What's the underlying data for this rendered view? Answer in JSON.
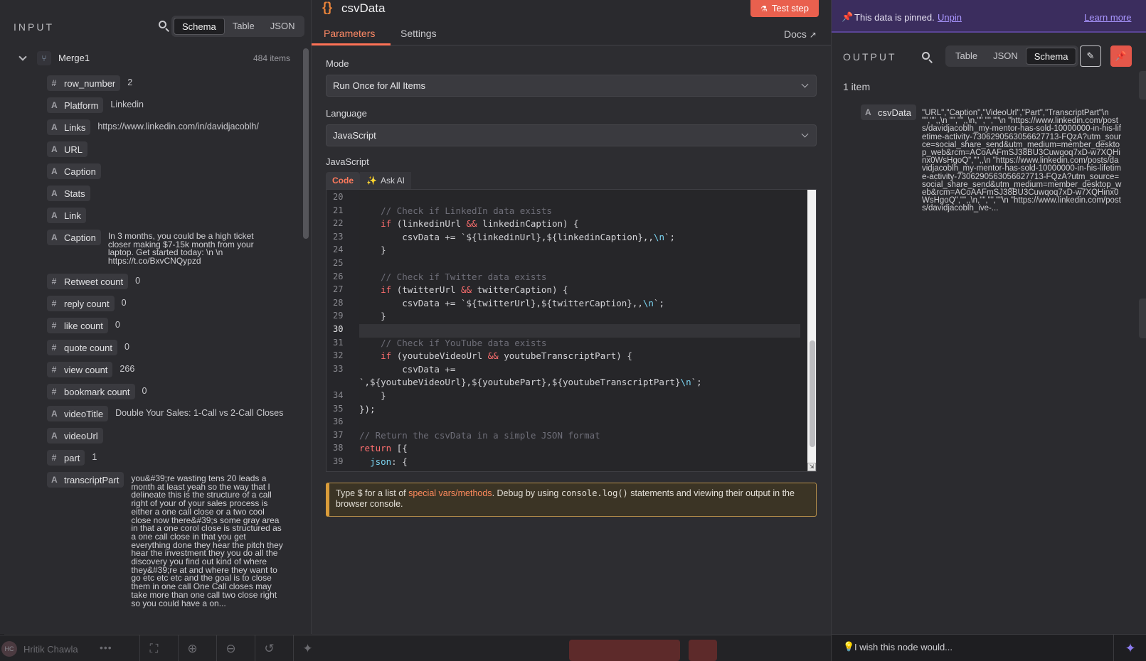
{
  "input": {
    "title": "INPUT",
    "view_tabs": [
      "Schema",
      "Table",
      "JSON"
    ],
    "active_view": "Schema",
    "node_name": "Merge1",
    "item_count": "484 items",
    "fields": [
      {
        "type": "#",
        "name": "row_number",
        "value": "2"
      },
      {
        "type": "A",
        "name": "Platform",
        "value": "Linkedin"
      },
      {
        "type": "A",
        "name": "Links",
        "value": "https://www.linkedin.com/in/davidjacoblh/"
      },
      {
        "type": "A",
        "name": "URL",
        "value": ""
      },
      {
        "type": "A",
        "name": "Caption",
        "value": ""
      },
      {
        "type": "A",
        "name": "Stats",
        "value": ""
      },
      {
        "type": "A",
        "name": "Link",
        "value": ""
      },
      {
        "type": "A",
        "name": "Caption",
        "value": "In 3 months, you could be a high ticket closer making $7-15k month from your laptop. Get started today: \\n \\n https://t.co/BxvCNQypzd"
      },
      {
        "type": "#",
        "name": "Retweet count",
        "value": "0"
      },
      {
        "type": "#",
        "name": "reply count",
        "value": "0"
      },
      {
        "type": "#",
        "name": "like count",
        "value": "0"
      },
      {
        "type": "#",
        "name": "quote count",
        "value": "0"
      },
      {
        "type": "#",
        "name": "view count",
        "value": "266"
      },
      {
        "type": "#",
        "name": "bookmark count",
        "value": "0"
      },
      {
        "type": "A",
        "name": "videoTitle",
        "value": "Double Your Sales: 1-Call vs 2-Call Closes"
      },
      {
        "type": "A",
        "name": "videoUrl",
        "value": ""
      },
      {
        "type": "#",
        "name": "part",
        "value": "1"
      },
      {
        "type": "A",
        "name": "transcriptPart",
        "value": "you&#39;re wasting tens 20 leads a month at least yeah so the way that I delineate this is the structure of a call right of your of your sales process is either a one call close or a two cool close now there&#39;s some gray area in that a one corol close is structured as a one call close in that you get everything done they hear the pitch they hear the investment they you do all the discovery you find out kind of where they&#39;re at and where they want to go etc etc etc and the goal is to close them in one call One Call closes may take more than one call two close right so you could have a on..."
      }
    ]
  },
  "node": {
    "icon": "{}",
    "title": "csvData",
    "test_button": "Test step",
    "tabs": [
      "Parameters",
      "Settings"
    ],
    "active_tab": "Parameters",
    "docs": "Docs",
    "mode_label": "Mode",
    "mode_value": "Run Once for All Items",
    "language_label": "Language",
    "language_value": "JavaScript",
    "code_label": "JavaScript",
    "code_tab": "Code",
    "ai_tab": "Ask AI",
    "hint_prefix": "Type $ for a list of ",
    "hint_link": "special vars/methods",
    "hint_middle": ". Debug by using ",
    "hint_code": "console.log()",
    "hint_suffix": " statements and viewing their output in the browser console.",
    "code_lines": [
      {
        "n": "20",
        "text": ""
      },
      {
        "n": "21",
        "text": "    // Check if LinkedIn data exists"
      },
      {
        "n": "22",
        "text": "    if (linkedinUrl && linkedinCaption) {"
      },
      {
        "n": "23",
        "text": "        csvData += `${linkedinUrl},${linkedinCaption},,\\n`;"
      },
      {
        "n": "24",
        "text": "    }"
      },
      {
        "n": "25",
        "text": ""
      },
      {
        "n": "26",
        "text": "    // Check if Twitter data exists"
      },
      {
        "n": "27",
        "text": "    if (twitterUrl && twitterCaption) {"
      },
      {
        "n": "28",
        "text": "        csvData += `${twitterUrl},${twitterCaption},,\\n`;"
      },
      {
        "n": "29",
        "text": "    }"
      },
      {
        "n": "30",
        "text": ""
      },
      {
        "n": "31",
        "text": "    // Check if YouTube data exists"
      },
      {
        "n": "32",
        "text": "    if (youtubeVideoUrl && youtubeTranscriptPart) {"
      },
      {
        "n": "33",
        "text": "        csvData +="
      },
      {
        "n": "",
        "text": "`,${youtubeVideoUrl},${youtubePart},${youtubeTranscriptPart}\\n`;"
      },
      {
        "n": "34",
        "text": "    }"
      },
      {
        "n": "35",
        "text": "});"
      },
      {
        "n": "36",
        "text": ""
      },
      {
        "n": "37",
        "text": "// Return the csvData in a simple JSON format"
      },
      {
        "n": "38",
        "text": "return [{"
      },
      {
        "n": "39",
        "text": "  json: {"
      }
    ],
    "current_line": "30"
  },
  "output": {
    "pinned_text": "This data is pinned.",
    "unpin": "Unpin",
    "learn_more": "Learn more",
    "title": "OUTPUT",
    "view_tabs": [
      "Table",
      "JSON",
      "Schema"
    ],
    "active_view": "Schema",
    "item_count": "1 item",
    "field_type": "A",
    "field_name": "csvData",
    "field_value": "\"URL\",\"Caption\",\"VideoUrl\",\"Part\",\"TranscriptPart\"\\n \"\",\"\",,\\n \"\",\"\",,\\n,\"\",\"\",\"\"\\n \"https://www.linkedin.com/posts/davidjacoblh_my-mentor-has-sold-10000000-in-his-lifetime-activity-7306290563056627713-FQzA?utm_source=social_share_send&utm_medium=member_desktop_web&rcm=ACoAAFmSJ38BU3Cuwqoq7xD-w7XQHinx0WsHgoQ\",\"\",,\\n \"https://www.linkedin.com/posts/davidjacoblh_my-mentor-has-sold-10000000-in-his-lifetime-activity-7306290563056627713-FQzA?utm_source=social_share_send&utm_medium=member_desktop_web&rcm=ACoAAFmSJ38BU3Cuwqoq7xD-w7XQHinx0WsHgoQ\",\"\",,\\n,\"\",\"\",\"\"\\n \"https://www.linkedin.com/posts/davidjacoblh_ive-..."
  },
  "footer": {
    "user_initials": "HC",
    "user_name": "Hritik Chawla",
    "more": "•••",
    "wish": "I wish this node would..."
  },
  "colors": {
    "accent": "#ff7256",
    "pin_banner": "#3b2d5e",
    "pin_link": "#a996ff",
    "hint_border": "#d99c3a"
  }
}
